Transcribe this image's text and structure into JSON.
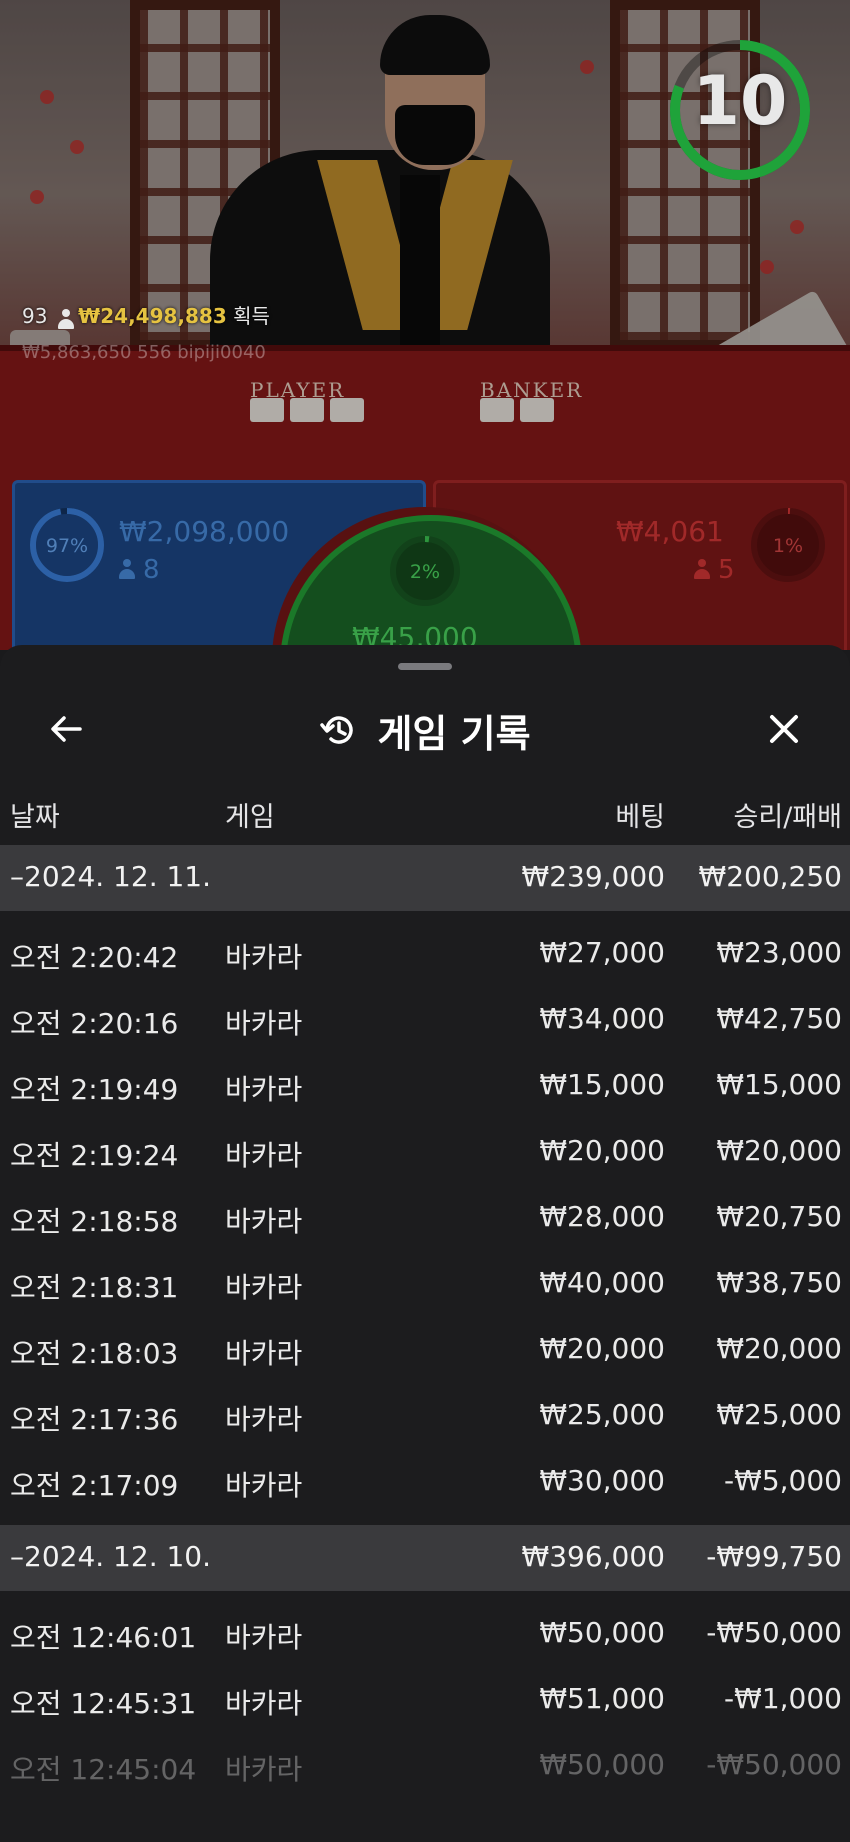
{
  "timer": {
    "seconds": "10",
    "ring_color": "#1fa33a"
  },
  "ticker": {
    "count": "93",
    "amount": "₩24,498,883",
    "suffix": "획득",
    "second_line": "₩5,863,650  556  bipiji0040"
  },
  "table_labels": {
    "player": "PLAYER",
    "banker": "BANKER"
  },
  "betting": {
    "player": {
      "percent": "97%",
      "amount": "₩2,098,000",
      "count": "8",
      "color": "#2f6ac0"
    },
    "banker": {
      "percent": "1%",
      "amount": "₩4,061",
      "count": "5",
      "color": "#c82a2a"
    },
    "tie": {
      "percent": "2%",
      "amount": "₩45,000",
      "color": "#26a83a"
    }
  },
  "history": {
    "title": "게임 기록",
    "back_icon": "arrow-left-icon",
    "history_icon": "history-clock-icon",
    "close_icon": "close-icon",
    "columns": {
      "date": "날짜",
      "game": "게임",
      "bet": "베팅",
      "win_loss": "승리/패배"
    },
    "groups": [
      {
        "date": "–2024. 12. 11.",
        "bet_total": "₩239,000",
        "win_total": "₩200,250",
        "rows": [
          {
            "time": "오전 2:20:42",
            "game": "바카라",
            "bet": "₩27,000",
            "win": "₩23,000"
          },
          {
            "time": "오전 2:20:16",
            "game": "바카라",
            "bet": "₩34,000",
            "win": "₩42,750"
          },
          {
            "time": "오전 2:19:49",
            "game": "바카라",
            "bet": "₩15,000",
            "win": "₩15,000"
          },
          {
            "time": "오전 2:19:24",
            "game": "바카라",
            "bet": "₩20,000",
            "win": "₩20,000"
          },
          {
            "time": "오전 2:18:58",
            "game": "바카라",
            "bet": "₩28,000",
            "win": "₩20,750"
          },
          {
            "time": "오전 2:18:31",
            "game": "바카라",
            "bet": "₩40,000",
            "win": "₩38,750"
          },
          {
            "time": "오전 2:18:03",
            "game": "바카라",
            "bet": "₩20,000",
            "win": "₩20,000"
          },
          {
            "time": "오전 2:17:36",
            "game": "바카라",
            "bet": "₩25,000",
            "win": "₩25,000"
          },
          {
            "time": "오전 2:17:09",
            "game": "바카라",
            "bet": "₩30,000",
            "win": "-₩5,000"
          }
        ]
      },
      {
        "date": "–2024. 12. 10.",
        "bet_total": "₩396,000",
        "win_total": "-₩99,750",
        "rows": [
          {
            "time": "오전 12:46:01",
            "game": "바카라",
            "bet": "₩50,000",
            "win": "-₩50,000"
          },
          {
            "time": "오전 12:45:31",
            "game": "바카라",
            "bet": "₩51,000",
            "win": "-₩1,000"
          },
          {
            "time": "오전 12:45:04",
            "game": "바카라",
            "bet": "₩50,000",
            "win": "-₩50,000"
          }
        ]
      }
    ]
  }
}
